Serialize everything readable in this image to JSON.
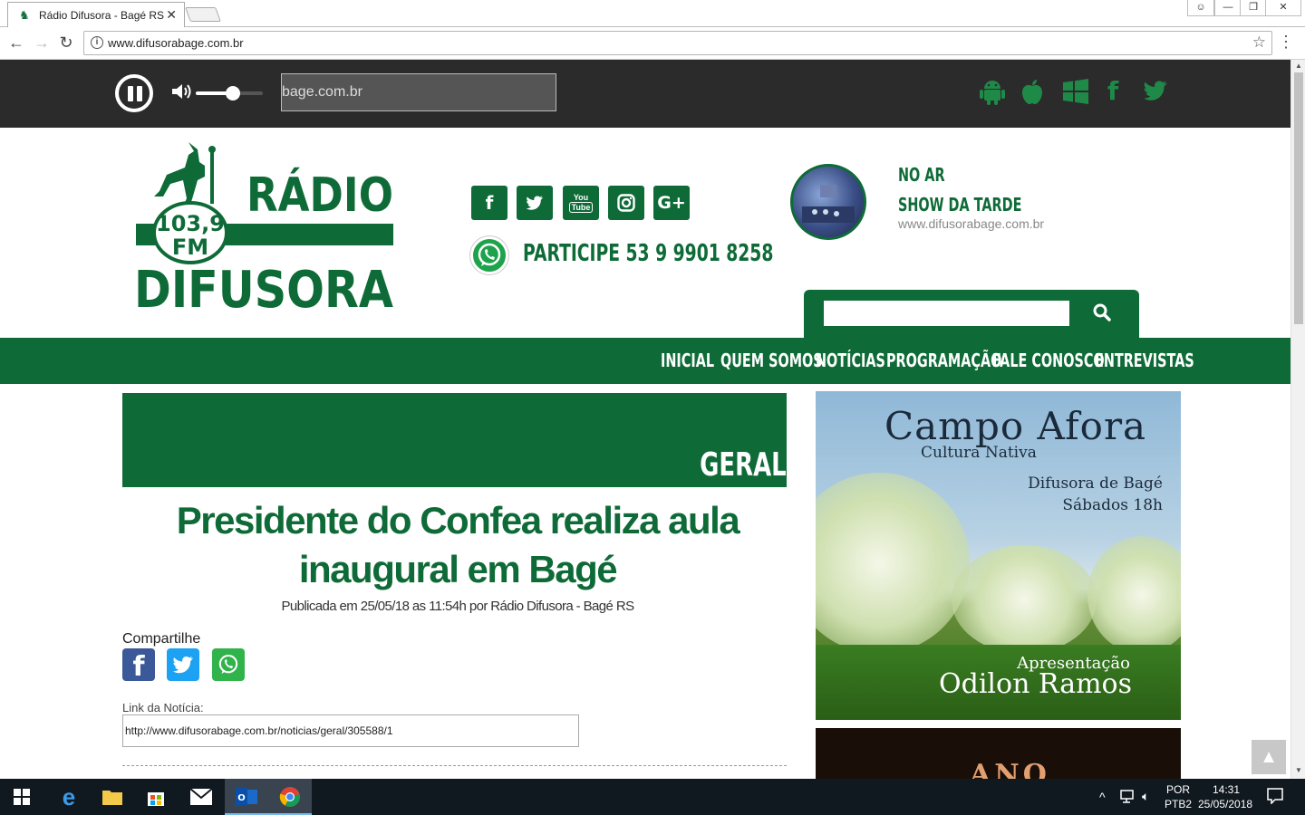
{
  "browser": {
    "tab_title": "Rádio Difusora - Bagé RS",
    "url": "www.difusorabage.com.br"
  },
  "player": {
    "stream_text": "bage.com.br",
    "volume_percent": 55,
    "platforms": [
      "android-icon",
      "apple-icon",
      "windows-icon",
      "facebook-icon",
      "twitter-icon"
    ]
  },
  "header": {
    "logo": {
      "top_word": "RÁDIO",
      "frequency": "103,9",
      "band": "FM",
      "bottom_word": "DIFUSORA"
    },
    "social": [
      {
        "name": "facebook-icon",
        "glyph": "f"
      },
      {
        "name": "twitter-icon",
        "glyph": "t"
      },
      {
        "name": "youtube-icon",
        "glyph": "You Tube"
      },
      {
        "name": "instagram-icon",
        "glyph": "◎"
      },
      {
        "name": "google-plus-icon",
        "glyph": "G+"
      }
    ],
    "participe": "PARTICIPE 53 9 9901 8258",
    "on_air": {
      "label": "NO AR",
      "show": "SHOW DA TARDE",
      "url": "www.difusorabage.com.br"
    },
    "search_placeholder": ""
  },
  "nav": [
    "INICIAL",
    "QUEM SOMOS",
    "NOTÍCIAS",
    "PROGRAMAÇÃO",
    "FALE CONOSCO",
    "ENTREVISTAS"
  ],
  "article": {
    "category": "GERAL",
    "headline": "Presidente do Confea realiza aula inaugural em Bagé",
    "published": "Publicada em 25/05/18 as 11:54h por Rádio Difusora - Bagé RS",
    "share_label": "Compartilhe",
    "link_label": "Link da Notícia:",
    "link_value": "http://www.difusorabage.com.br/noticias/geral/305588/1"
  },
  "ad": {
    "title": "Campo Afora",
    "subtitle": "Cultura Nativa",
    "line1": "Difusora de Bagé",
    "line2": "Sábados 18h",
    "presenter_label": "Apresentação",
    "presenter_name": "Odilon Ramos"
  },
  "ad2": {
    "text": "ANO"
  },
  "taskbar": {
    "lang_top": "POR",
    "lang_bottom": "PTB2",
    "time": "14:31",
    "date": "25/05/2018"
  },
  "colors": {
    "brand_green": "#0e6b37",
    "player_bg": "#2b2b2b"
  }
}
